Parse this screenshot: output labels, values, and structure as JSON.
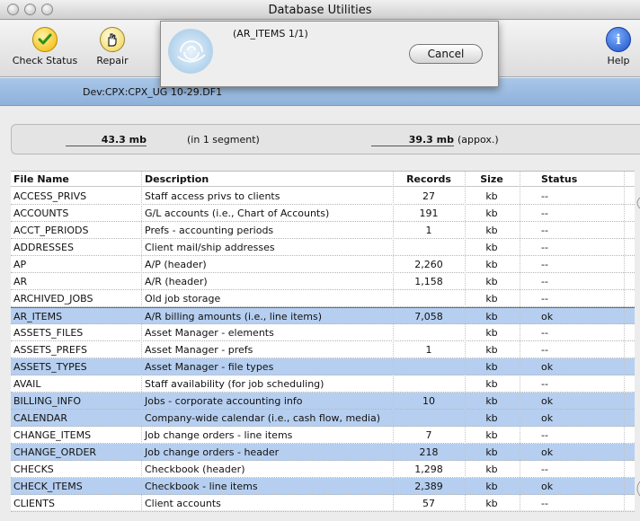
{
  "window": {
    "title": "Database Utilities"
  },
  "toolbar": {
    "check_status": "Check Status",
    "repair": "Repair",
    "help": "Help"
  },
  "progress": {
    "message": "(AR_ITEMS 1/1)",
    "cancel": "Cancel"
  },
  "dev_path": "Dev:CPX:CPX_UG 10-29.DF1",
  "info": {
    "size1": "43.3 mb",
    "segments": "(in 1 segment)",
    "size2": "39.3 mb",
    "approx": "(appox.)"
  },
  "table": {
    "headers": [
      "File Name",
      "Description",
      "Records",
      "Size",
      "Status"
    ],
    "rows": [
      {
        "name": "ACCESS_PRIVS",
        "desc": "Staff access privs to clients",
        "records": "27",
        "size": "kb",
        "status": "--"
      },
      {
        "name": "ACCOUNTS",
        "desc": "G/L accounts (i.e., Chart of Accounts)",
        "records": "191",
        "size": "kb",
        "status": "--"
      },
      {
        "name": "ACCT_PERIODS",
        "desc": "Prefs - accounting periods",
        "records": "1",
        "size": "kb",
        "status": "--"
      },
      {
        "name": "ADDRESSES",
        "desc": "Client mail/ship addresses",
        "records": "",
        "size": "kb",
        "status": "--"
      },
      {
        "name": "AP",
        "desc": "A/P (header)",
        "records": "2,260",
        "size": "kb",
        "status": "--"
      },
      {
        "name": "AR",
        "desc": "A/R (header)",
        "records": "1,158",
        "size": "kb",
        "status": "--"
      },
      {
        "name": "ARCHIVED_JOBS",
        "desc": "Old job storage",
        "records": "",
        "size": "kb",
        "status": "--"
      },
      {
        "name": "AR_ITEMS",
        "desc": "A/R billing amounts (i.e., line items)",
        "records": "7,058",
        "size": "kb",
        "status": "ok"
      },
      {
        "name": "ASSETS_FILES",
        "desc": "Asset Manager - elements",
        "records": "",
        "size": "kb",
        "status": "--"
      },
      {
        "name": "ASSETS_PREFS",
        "desc": "Asset Manager - prefs",
        "records": "1",
        "size": "kb",
        "status": "--"
      },
      {
        "name": "ASSETS_TYPES",
        "desc": "Asset Manager - file types",
        "records": "",
        "size": "kb",
        "status": "ok"
      },
      {
        "name": "AVAIL",
        "desc": "Staff availability (for job scheduling)",
        "records": "",
        "size": "kb",
        "status": "--"
      },
      {
        "name": "BILLING_INFO",
        "desc": "Jobs - corporate accounting info",
        "records": "10",
        "size": "kb",
        "status": "ok"
      },
      {
        "name": "CALENDAR",
        "desc": "Company-wide calendar (i.e., cash flow, media)",
        "records": "",
        "size": "kb",
        "status": "ok"
      },
      {
        "name": "CHANGE_ITEMS",
        "desc": "Job change orders - line items",
        "records": "7",
        "size": "kb",
        "status": "--"
      },
      {
        "name": "CHANGE_ORDER",
        "desc": "Job change orders - header",
        "records": "218",
        "size": "kb",
        "status": "ok"
      },
      {
        "name": "CHECKS",
        "desc": "Checkbook (header)",
        "records": "1,298",
        "size": "kb",
        "status": "--"
      },
      {
        "name": "CHECK_ITEMS",
        "desc": "Checkbook - line items",
        "records": "2,389",
        "size": "kb",
        "status": "ok"
      },
      {
        "name": "CLIENTS",
        "desc": "Client accounts",
        "records": "57",
        "size": "kb",
        "status": "--"
      }
    ]
  }
}
